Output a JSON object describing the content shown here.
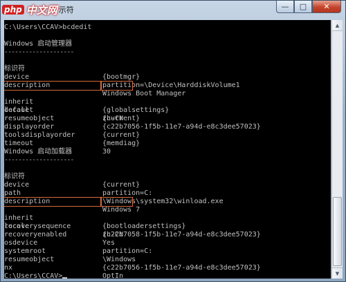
{
  "window": {
    "icon": "cmd-icon",
    "watermark_logo": "php",
    "watermark_text": "中文网",
    "watermark_tail": "示符",
    "controls": {
      "minimize": "—",
      "maximize": "□",
      "close": "✕"
    }
  },
  "console": {
    "command_line": "C:\\Users\\CCAV>bcdedit",
    "section1": {
      "title": "Windows 启动管理器",
      "rule": "--------------------",
      "rows": [
        {
          "key": "标识符",
          "value": "{bootmgr}"
        },
        {
          "key": "device",
          "value": "partition=\\Device\\HarddiskVolume1"
        },
        {
          "key": "description",
          "value": "Windows Boot Manager"
        },
        {
          "key": "locale",
          "value": "zh-CN"
        },
        {
          "key": "inherit",
          "value": "{globalsettings}"
        },
        {
          "key": "default",
          "value": "{current}"
        },
        {
          "key": "resumeobject",
          "value": "{c22b7056-1f5b-11e7-a94d-e8c3dee57023}"
        },
        {
          "key": "displayorder",
          "value": "{current}"
        },
        {
          "key": "toolsdisplayorder",
          "value": "{memdiag}"
        },
        {
          "key": "timeout",
          "value": "30"
        }
      ]
    },
    "section2": {
      "title": "Windows 启动加载器",
      "rule": "--------------------",
      "rows": [
        {
          "key": "标识符",
          "value": "{current}"
        },
        {
          "key": "device",
          "value": "partition=C:"
        },
        {
          "key": "path",
          "value": "\\Windows\\system32\\winload.exe"
        },
        {
          "key": "description",
          "value": "Windows 7"
        },
        {
          "key": "locale",
          "value": "zh-CN"
        },
        {
          "key": "inherit",
          "value": "{bootloadersettings}"
        },
        {
          "key": "recoverysequence",
          "value": "{c22b7058-1f5b-11e7-a94d-e8c3dee57023}"
        },
        {
          "key": "recoveryenabled",
          "value": "Yes"
        },
        {
          "key": "osdevice",
          "value": "partition=C:"
        },
        {
          "key": "systemroot",
          "value": "\\Windows"
        },
        {
          "key": "resumeobject",
          "value": "{c22b7056-1f5b-11e7-a94d-e8c3dee57023}"
        },
        {
          "key": "nx",
          "value": "OptIn"
        }
      ]
    },
    "prompt": "C:\\Users\\CCAV>"
  },
  "colors": {
    "console_bg": "#000000",
    "console_fg": "#c0c0c0",
    "highlight": "#d86a3a"
  }
}
